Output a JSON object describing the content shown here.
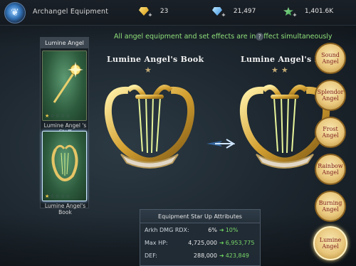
{
  "header": {
    "title": "Archangel Equipment",
    "resources": [
      {
        "icon": "gold-gem-icon",
        "value": "23"
      },
      {
        "icon": "blue-diamond-icon",
        "value": "21,497"
      },
      {
        "icon": "green-star-icon",
        "value": "1,401.6K"
      }
    ]
  },
  "info_text": "All angel equipment and set effects are in",
  "info_text_2": "ffect simultaneously",
  "set_panel": {
    "title": "Lumine Angel Set",
    "items": [
      {
        "label": "Lumine Angel 's Staff",
        "stars": 1,
        "max_stars": 5
      },
      {
        "label": "Lumine Angel's Book",
        "stars": 1,
        "max_stars": 5
      }
    ]
  },
  "current": {
    "name": "Lumine Angel's Book",
    "stars": 1
  },
  "next": {
    "name": "Lumine Angel's Bo",
    "stars": 2
  },
  "sets": [
    {
      "label": "Sound Angel"
    },
    {
      "label": "Splendor Angel"
    },
    {
      "label": "Frost Angel"
    },
    {
      "label": "Rainbow Angel"
    },
    {
      "label": "Burning Angel"
    },
    {
      "label": "Lumine Angel"
    }
  ],
  "attributes": {
    "title": "Equipment Star Up Attributes",
    "rows": [
      {
        "name": "Arkh DMG RDX:",
        "current": "6%",
        "next": "10%"
      },
      {
        "name": "Max HP:",
        "current": "4,725,000",
        "next": "6,953,775"
      },
      {
        "name": "DEF:",
        "current": "288,000",
        "next": "423,849"
      }
    ]
  },
  "colors": {
    "accent_green": "#8fe07a",
    "gold": "#e9c77c",
    "side_text": "#7d1c1c"
  }
}
